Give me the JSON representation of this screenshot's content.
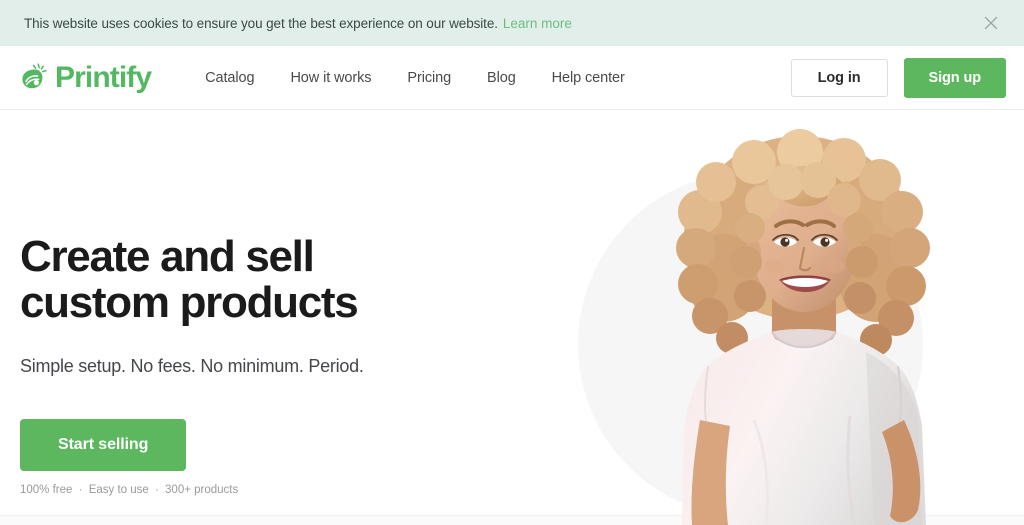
{
  "colors": {
    "brand_green": "#53b860",
    "button_green": "#5cb75f",
    "cookie_bg": "#e2eeea",
    "cookie_link": "#6cbf7b",
    "heading": "#1b1b1b",
    "body_text": "#44474a",
    "fineprint": "#9a9a9a",
    "blob": "#f6f6f6"
  },
  "cookie_banner": {
    "message": "This website uses cookies to ensure you get the best experience on our website.",
    "link_label": "Learn more",
    "close_icon": "close-icon"
  },
  "header": {
    "logo": {
      "icon": "printify-stamp-icon",
      "wordmark": "Printify"
    },
    "nav": [
      {
        "label": "Catalog"
      },
      {
        "label": "How it works"
      },
      {
        "label": "Pricing"
      },
      {
        "label": "Blog"
      },
      {
        "label": "Help center"
      }
    ],
    "actions": {
      "login_label": "Log in",
      "signup_label": "Sign up"
    }
  },
  "hero": {
    "title_line1": "Create and sell",
    "title_line2": "custom products",
    "subtitle": "Simple setup. No fees. No minimum. Period.",
    "cta_label": "Start selling",
    "fineprint": {
      "item1": "100% free",
      "sep1": "·",
      "item2": "Easy to use",
      "sep2": "·",
      "item3": "300+ products"
    },
    "image": {
      "alt": "Smiling woman with curly blonde hair wearing a light pink t-shirt",
      "name": "hero-model-photo"
    }
  }
}
